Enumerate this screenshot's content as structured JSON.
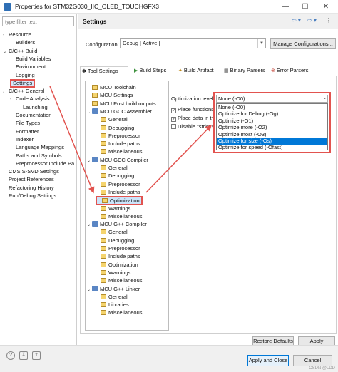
{
  "window": {
    "title": "Properties for STM32G030_IIC_OLED_TOUCHGFX3",
    "controls": [
      "—",
      "☐",
      "✕"
    ]
  },
  "sidebar": {
    "filter_placeholder": "type filter text",
    "items": [
      {
        "label": "Resource",
        "toggle": "›"
      },
      {
        "label": "Builders",
        "toggle": ""
      },
      {
        "label": "C/C++ Build",
        "toggle": "⌄"
      },
      {
        "label": "Build Variables",
        "toggle": ""
      },
      {
        "label": "Environment",
        "toggle": ""
      },
      {
        "label": "Logging",
        "toggle": ""
      },
      {
        "label": "Settings",
        "toggle": ""
      },
      {
        "label": "C/C++ General",
        "toggle": "›"
      },
      {
        "label": "Code Analysis",
        "toggle": "›"
      },
      {
        "label": "Launching",
        "toggle": ""
      },
      {
        "label": "Documentation",
        "toggle": ""
      },
      {
        "label": "File Types",
        "toggle": ""
      },
      {
        "label": "Formatter",
        "toggle": ""
      },
      {
        "label": "Indexer",
        "toggle": ""
      },
      {
        "label": "Language Mappings",
        "toggle": ""
      },
      {
        "label": "Paths and Symbols",
        "toggle": ""
      },
      {
        "label": "Preprocessor Include Pa",
        "toggle": ""
      },
      {
        "label": "CMSIS-SVD Settings",
        "toggle": ""
      },
      {
        "label": "Project References",
        "toggle": ""
      },
      {
        "label": "Refactoring History",
        "toggle": ""
      },
      {
        "label": "Run/Debug Settings",
        "toggle": ""
      }
    ]
  },
  "header": {
    "title": "Settings",
    "nav_icons": [
      "back-arrow",
      "forward-arrow",
      "menu"
    ],
    "nav_glyphs": [
      "⇦ ▾",
      "⇨ ▾",
      "⋮"
    ]
  },
  "configuration": {
    "label": "Configuration:",
    "value": "Debug  [ Active ]",
    "manage_button": "Manage Configurations..."
  },
  "tabs": [
    {
      "label": "Tool Settings",
      "icon": "✱"
    },
    {
      "label": "Build Steps",
      "icon": "▶"
    },
    {
      "label": "Build Artifact",
      "icon": "✦"
    },
    {
      "label": "Binary Parsers",
      "icon": "▦"
    },
    {
      "label": "Error Parsers",
      "icon": "⊗"
    }
  ],
  "tool_tree": [
    {
      "label": "MCU Toolchain",
      "level": 0,
      "kind": "folder",
      "toggle": ""
    },
    {
      "label": "MCU Settings",
      "level": 0,
      "kind": "folder",
      "toggle": ""
    },
    {
      "label": "MCU Post build outputs",
      "level": 0,
      "kind": "folder",
      "toggle": ""
    },
    {
      "label": "MCU GCC Assembler",
      "level": 0,
      "kind": "tool",
      "toggle": "⌄"
    },
    {
      "label": "General",
      "level": 1,
      "kind": "folder",
      "toggle": ""
    },
    {
      "label": "Debugging",
      "level": 1,
      "kind": "folder",
      "toggle": ""
    },
    {
      "label": "Preprocessor",
      "level": 1,
      "kind": "folder",
      "toggle": ""
    },
    {
      "label": "Include paths",
      "level": 1,
      "kind": "folder",
      "toggle": ""
    },
    {
      "label": "Miscellaneous",
      "level": 1,
      "kind": "folder",
      "toggle": ""
    },
    {
      "label": "MCU GCC Compiler",
      "level": 0,
      "kind": "tool",
      "toggle": "⌄"
    },
    {
      "label": "General",
      "level": 1,
      "kind": "folder",
      "toggle": ""
    },
    {
      "label": "Debugging",
      "level": 1,
      "kind": "folder",
      "toggle": ""
    },
    {
      "label": "Preprocessor",
      "level": 1,
      "kind": "folder",
      "toggle": ""
    },
    {
      "label": "Include paths",
      "level": 1,
      "kind": "folder",
      "toggle": ""
    },
    {
      "label": "Optimization",
      "level": 1,
      "kind": "folder",
      "toggle": ""
    },
    {
      "label": "Warnings",
      "level": 1,
      "kind": "folder",
      "toggle": ""
    },
    {
      "label": "Miscellaneous",
      "level": 1,
      "kind": "folder",
      "toggle": ""
    },
    {
      "label": "MCU G++ Compiler",
      "level": 0,
      "kind": "tool",
      "toggle": "⌄"
    },
    {
      "label": "General",
      "level": 1,
      "kind": "folder",
      "toggle": ""
    },
    {
      "label": "Debugging",
      "level": 1,
      "kind": "folder",
      "toggle": ""
    },
    {
      "label": "Preprocessor",
      "level": 1,
      "kind": "folder",
      "toggle": ""
    },
    {
      "label": "Include paths",
      "level": 1,
      "kind": "folder",
      "toggle": ""
    },
    {
      "label": "Optimization",
      "level": 1,
      "kind": "folder",
      "toggle": ""
    },
    {
      "label": "Warnings",
      "level": 1,
      "kind": "folder",
      "toggle": ""
    },
    {
      "label": "Miscellaneous",
      "level": 1,
      "kind": "folder",
      "toggle": ""
    },
    {
      "label": "MCU G++ Linker",
      "level": 0,
      "kind": "tool",
      "toggle": "⌄"
    },
    {
      "label": "General",
      "level": 1,
      "kind": "folder",
      "toggle": ""
    },
    {
      "label": "Libraries",
      "level": 1,
      "kind": "folder",
      "toggle": ""
    },
    {
      "label": "Miscellaneous",
      "level": 1,
      "kind": "folder",
      "toggle": ""
    }
  ],
  "optimization": {
    "label": "Optimization level",
    "current": "None (-O0)",
    "options": [
      "None (-O0)",
      "Optimize for Debug (-Og)",
      "Optimize (-O1)",
      "Optimize more (-O2)",
      "Optimize most (-O3)",
      "Optimize for size (-Os)",
      "Optimize for speed (-Ofast)"
    ],
    "highlighted": "Optimize for size (-Os)",
    "checkboxes": [
      {
        "label": "Place functions in",
        "checked": true
      },
      {
        "label": "Place data in thei",
        "checked": true
      },
      {
        "label": "Disable \"strict ali",
        "checked": false
      }
    ]
  },
  "buttons": {
    "restore_defaults": "Restore Defaults",
    "apply": "Apply",
    "apply_and_close": "Apply and Close",
    "cancel": "Cancel"
  },
  "bottom_icons": [
    "help-icon",
    "import-icon",
    "export-icon"
  ],
  "bottom_glyphs": [
    "?",
    "↧",
    "↥"
  ],
  "watermark": "CSDN @LDD",
  "colors": {
    "highlight_border": "#e2534f",
    "selection_blue": "#0078d7"
  }
}
